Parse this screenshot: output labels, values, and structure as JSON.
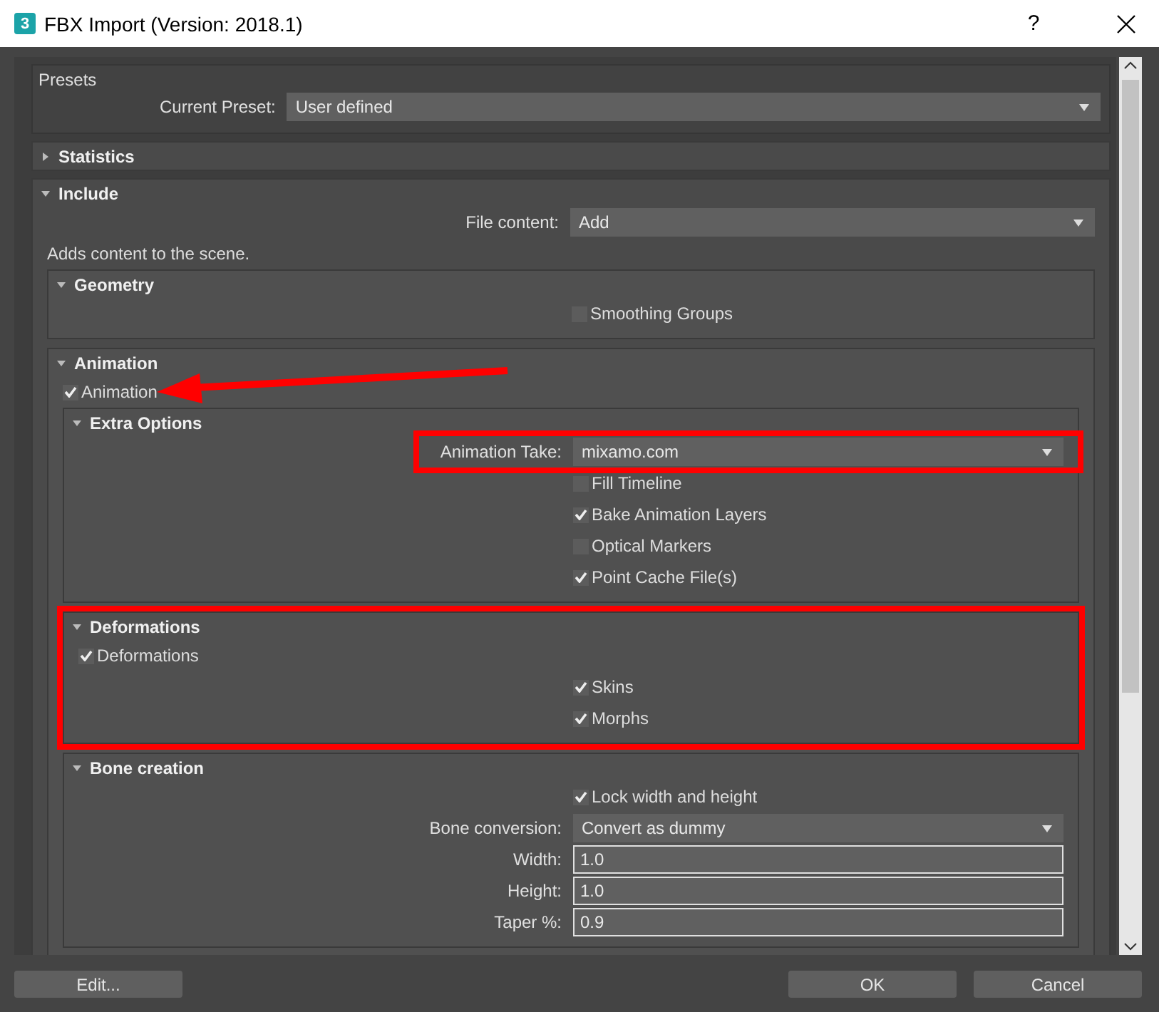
{
  "window": {
    "icon_text": "3",
    "title": "FBX Import (Version: 2018.1)",
    "help": "?"
  },
  "presets": {
    "title": "Presets",
    "label": "Current Preset:",
    "value": "User defined"
  },
  "sections": [
    {
      "title": "Statistics",
      "expanded": false
    },
    {
      "title": "Include",
      "expanded": true,
      "rows": [
        {
          "kind": "dropdown",
          "label": "File content:",
          "value": "Add"
        },
        {
          "kind": "text",
          "text": "Adds content to the scene."
        }
      ],
      "children": [
        {
          "title": "Geometry",
          "expanded": true,
          "rows": [
            {
              "kind": "check",
              "label": "Smoothing Groups",
              "checked": false
            }
          ]
        },
        {
          "title": "Animation",
          "expanded": true,
          "rows": [
            {
              "kind": "toggle",
              "label": "Animation",
              "checked": true,
              "arrow": true
            }
          ],
          "children": [
            {
              "title": "Extra Options",
              "expanded": true,
              "rows": [
                {
                  "kind": "dropdown",
                  "label": "Animation Take:",
                  "value": "mixamo.com",
                  "highlighted": true
                },
                {
                  "kind": "check",
                  "label": "Fill Timeline",
                  "checked": false
                },
                {
                  "kind": "check",
                  "label": "Bake Animation Layers",
                  "checked": true
                },
                {
                  "kind": "check",
                  "label": "Optical Markers",
                  "checked": false
                },
                {
                  "kind": "check",
                  "label": "Point Cache File(s)",
                  "checked": true
                }
              ]
            },
            {
              "title": "Deformations",
              "expanded": true,
              "highlighted": true,
              "rows": [
                {
                  "kind": "toggle",
                  "label": "Deformations",
                  "checked": true
                },
                {
                  "kind": "check",
                  "label": "Skins",
                  "checked": true
                },
                {
                  "kind": "check",
                  "label": "Morphs",
                  "checked": true
                }
              ]
            },
            {
              "title": "Bone creation",
              "expanded": true,
              "rows": [
                {
                  "kind": "check",
                  "label": "Lock width and height",
                  "checked": true
                },
                {
                  "kind": "dropdown",
                  "label": "Bone conversion:",
                  "value": "Convert as dummy"
                },
                {
                  "kind": "field",
                  "label": "Width:",
                  "value": "1.0"
                },
                {
                  "kind": "field",
                  "label": "Height:",
                  "value": "1.0"
                },
                {
                  "kind": "field",
                  "label": "Taper %:",
                  "value": "0.9"
                }
              ]
            }
          ]
        }
      ]
    }
  ],
  "footer": {
    "left_buttons": [
      {
        "label": "Edit..."
      }
    ],
    "right_buttons": [
      {
        "label": "OK"
      },
      {
        "label": "Cancel"
      }
    ]
  }
}
